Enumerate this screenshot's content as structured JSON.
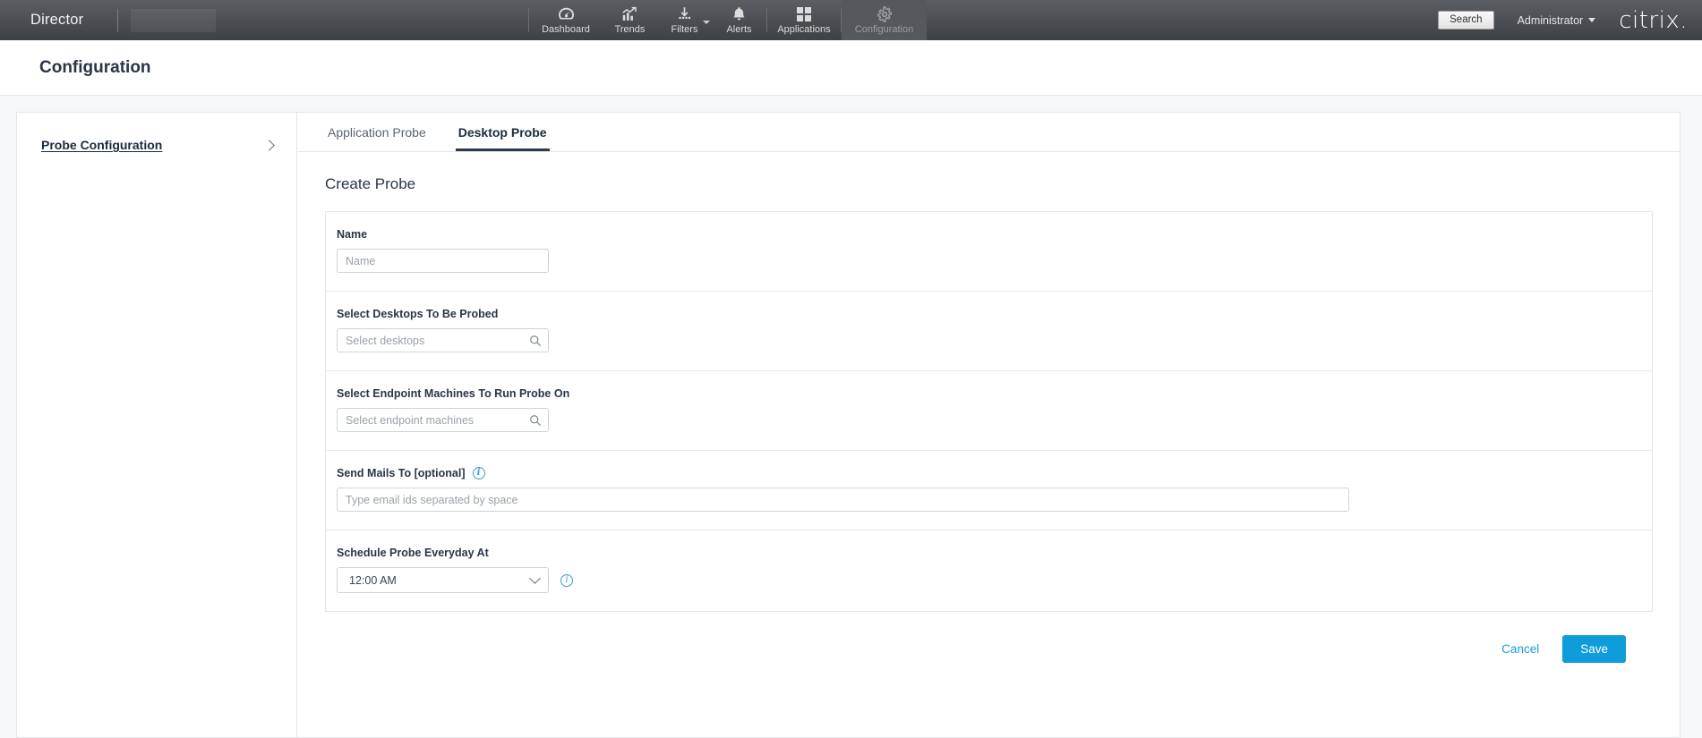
{
  "topbar": {
    "brand": "Director",
    "nav": [
      {
        "label": "Dashboard",
        "icon": "dashboard-gauge-icon",
        "active": false,
        "caret": false
      },
      {
        "label": "Trends",
        "icon": "trends-chart-icon",
        "active": false,
        "caret": false
      },
      {
        "label": "Filters",
        "icon": "filters-funnel-icon",
        "active": false,
        "caret": true
      },
      {
        "label": "Alerts",
        "icon": "alerts-bell-icon",
        "active": false,
        "caret": false
      },
      {
        "label": "Applications",
        "icon": "applications-grid-icon",
        "active": false,
        "caret": false
      },
      {
        "label": "Configuration",
        "icon": "configuration-gear-icon",
        "active": true,
        "caret": false
      }
    ],
    "search_label": "Search",
    "admin_label": "Administrator",
    "logo_text": "citrix",
    "logo_dot": "."
  },
  "page": {
    "title": "Configuration"
  },
  "sidebar": {
    "item_label": "Probe Configuration"
  },
  "tabs": [
    {
      "label": "Application Probe",
      "active": false
    },
    {
      "label": "Desktop Probe",
      "active": true
    }
  ],
  "form": {
    "section_title": "Create Probe",
    "name": {
      "label": "Name",
      "placeholder": "Name",
      "value": ""
    },
    "desktops": {
      "label": "Select Desktops To Be Probed",
      "placeholder": "Select desktops",
      "value": "",
      "icon": "search-icon"
    },
    "endpoints": {
      "label": "Select Endpoint Machines To Run Probe On",
      "placeholder": "Select endpoint machines",
      "value": "",
      "icon": "search-icon"
    },
    "mails": {
      "label": "Send Mails To [optional]",
      "placeholder": "Type email ids separated by space",
      "value": "",
      "info": "i"
    },
    "schedule": {
      "label": "Schedule Probe Everyday At",
      "value": "12:00 AM",
      "info": "i"
    }
  },
  "actions": {
    "cancel_label": "Cancel",
    "save_label": "Save"
  },
  "colors": {
    "accent_blue": "#0e9cda",
    "link_blue": "#1b9ad8",
    "topbar_dark": "#4a4d51",
    "tab_underline": "#2f3b4c"
  }
}
